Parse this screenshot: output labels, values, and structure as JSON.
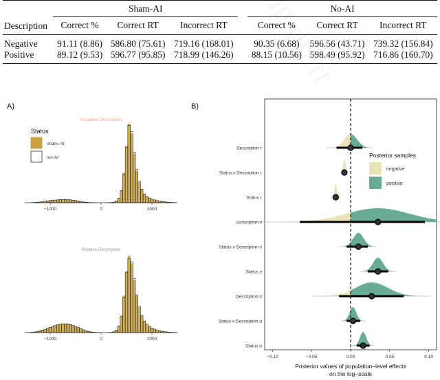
{
  "table": {
    "group_headers": [
      "Sham-AI",
      "No-AI"
    ],
    "columns": [
      "Description",
      "Correct %",
      "Correct RT",
      "Incorrect RT",
      "Correct %",
      "Correct RT",
      "Incorrect RT"
    ],
    "rows": [
      [
        "Negative",
        "91.11 (8.86)",
        "586.80 (75.61)",
        "719.16 (168.01)",
        "90.35 (6.68)",
        "596.56 (43.71)",
        "739.32 (156.84)"
      ],
      [
        "Positive",
        "89.12 (9.53)",
        "596.77 (95.85)",
        "718.99 (146.26)",
        "88.15 (10.56)",
        "598.49 (95.92)",
        "716.86 (160.70)"
      ]
    ]
  },
  "chart_data": [
    {
      "type": "bar",
      "panel_label": "A)",
      "subplots": [
        {
          "title": "Negative Description",
          "title_color": "#f4a582"
        },
        {
          "title": "Positive Description",
          "title_color": "#999999"
        }
      ],
      "legend": {
        "title": "Status",
        "entries": [
          {
            "name": "sham–AI",
            "color": "#c8a040"
          },
          {
            "name": "no–AI",
            "color": "#ffffff"
          }
        ],
        "placement": "top-left"
      },
      "xticks": [
        "−1000",
        "0",
        "1000"
      ],
      "xlim": [
        -1500,
        1500
      ],
      "bins_x": [
        -1450,
        -1400,
        -1350,
        -1300,
        -1250,
        -1200,
        -1150,
        -1100,
        -1050,
        -1000,
        -950,
        -900,
        -850,
        -800,
        -750,
        -700,
        -650,
        -600,
        -550,
        -500,
        -450,
        -400,
        -350,
        -300,
        -250,
        -200,
        -150,
        -100,
        -50,
        0,
        50,
        100,
        150,
        200,
        250,
        300,
        350,
        400,
        450,
        500,
        550,
        600,
        650,
        700,
        750,
        800,
        850,
        900,
        950,
        1000,
        1050,
        1100,
        1150,
        1200,
        1250,
        1300,
        1350,
        1400,
        1450
      ],
      "series": [
        {
          "name": "negative-sham-AI",
          "values": [
            0,
            0,
            0.2,
            0.4,
            0.6,
            0.9,
            1.3,
            1.8,
            2.3,
            2.8,
            3.2,
            3.5,
            3.8,
            4,
            4.2,
            4.3,
            4.1,
            3.8,
            3.3,
            2.8,
            2.2,
            1.6,
            1.1,
            0.7,
            0.4,
            0.2,
            0.1,
            0.1,
            0,
            0,
            0,
            0,
            0.1,
            0.3,
            0.8,
            2.5,
            6,
            16,
            38,
            72,
            100,
            88,
            62,
            40,
            26,
            17,
            11,
            8,
            6,
            4.5,
            3.5,
            2.8,
            2.1,
            1.6,
            1.2,
            0.8,
            0.5,
            0.3,
            0.1
          ]
        },
        {
          "name": "negative-no-AI",
          "values": [
            0,
            0,
            0.2,
            0.4,
            0.6,
            0.9,
            1.3,
            1.8,
            2.3,
            2.7,
            3.1,
            3.4,
            3.7,
            3.9,
            4.1,
            4.2,
            4,
            3.7,
            3.2,
            2.7,
            2.1,
            1.5,
            1,
            0.7,
            0.4,
            0.2,
            0.1,
            0.1,
            0,
            0,
            0,
            0,
            0.1,
            0.3,
            0.7,
            2.2,
            5.5,
            15,
            36,
            70,
            98,
            90,
            64,
            42,
            27,
            17,
            11,
            8,
            6,
            4.6,
            3.6,
            2.8,
            2.1,
            1.6,
            1.2,
            0.8,
            0.5,
            0.3,
            0.1
          ]
        },
        {
          "name": "positive-sham-AI",
          "values": [
            0,
            0.2,
            0.5,
            0.9,
            1.5,
            2.3,
            3.3,
            4.4,
            5.6,
            6.9,
            8.1,
            9.3,
            10.3,
            11,
            11.5,
            11.6,
            11.3,
            10.6,
            9.5,
            8.2,
            6.7,
            5.2,
            3.8,
            2.6,
            1.7,
            1,
            0.5,
            0.2,
            0.1,
            0,
            0,
            0,
            0.1,
            0.4,
            1.2,
            3.5,
            9,
            22,
            48,
            80,
            100,
            90,
            68,
            48,
            33,
            22,
            15,
            11,
            8,
            6,
            4.5,
            3.4,
            2.5,
            1.8,
            1.2,
            0.8,
            0.5,
            0.3,
            0.1
          ]
        },
        {
          "name": "positive-no-AI",
          "values": [
            0,
            0.2,
            0.5,
            0.9,
            1.5,
            2.3,
            3.3,
            4.4,
            5.6,
            6.8,
            8,
            9.2,
            10.2,
            10.9,
            11.4,
            11.5,
            11.2,
            10.5,
            9.4,
            8.1,
            6.6,
            5.1,
            3.7,
            2.5,
            1.6,
            1,
            0.5,
            0.2,
            0.1,
            0,
            0,
            0,
            0.1,
            0.4,
            1.1,
            3.2,
            8.5,
            21,
            46,
            78,
            96,
            92,
            70,
            49,
            34,
            22,
            15,
            11,
            8,
            6,
            4.6,
            3.4,
            2.5,
            1.8,
            1.2,
            0.8,
            0.5,
            0.3,
            0.1
          ]
        }
      ]
    },
    {
      "type": "scatter",
      "panel_label": "B)",
      "xlabel": "Posterior values of population–level effects\non the log–scale",
      "ylabel": "",
      "xlim": [
        -0.11,
        0.11
      ],
      "xticks": [
        "−0.10",
        "−0.05",
        "0.00",
        "0.05",
        "0.10"
      ],
      "xtick_values": [
        -0.1,
        -0.05,
        0.0,
        0.05,
        0.1
      ],
      "reference_line": 0,
      "legend": {
        "title": "Posterior samples",
        "entries": [
          {
            "name": "negative",
            "color": "#eae3b8"
          },
          {
            "name": "positive",
            "color": "#6aab94"
          }
        ],
        "placement": "right"
      },
      "categories": [
        "Description τ",
        "Status x Description τ",
        "Status τ",
        "Description ν",
        "Status x Description ν",
        "Status ν",
        "Description α",
        "Status x Description α",
        "Status α"
      ],
      "estimates": [
        0.0,
        -0.008,
        -0.019,
        0.035,
        0.01,
        0.035,
        0.027,
        0.003,
        0.016
      ],
      "interval_low": [
        -0.018,
        -0.01,
        -0.022,
        -0.065,
        -0.005,
        0.022,
        -0.015,
        -0.005,
        0.008
      ],
      "interval_high": [
        0.015,
        -0.006,
        -0.016,
        0.095,
        0.022,
        0.048,
        0.068,
        0.012,
        0.024
      ],
      "density_sign": [
        "mixed",
        "negative",
        "negative",
        "mixed",
        "positive",
        "positive",
        "mixed",
        "positive",
        "positive"
      ]
    }
  ]
}
